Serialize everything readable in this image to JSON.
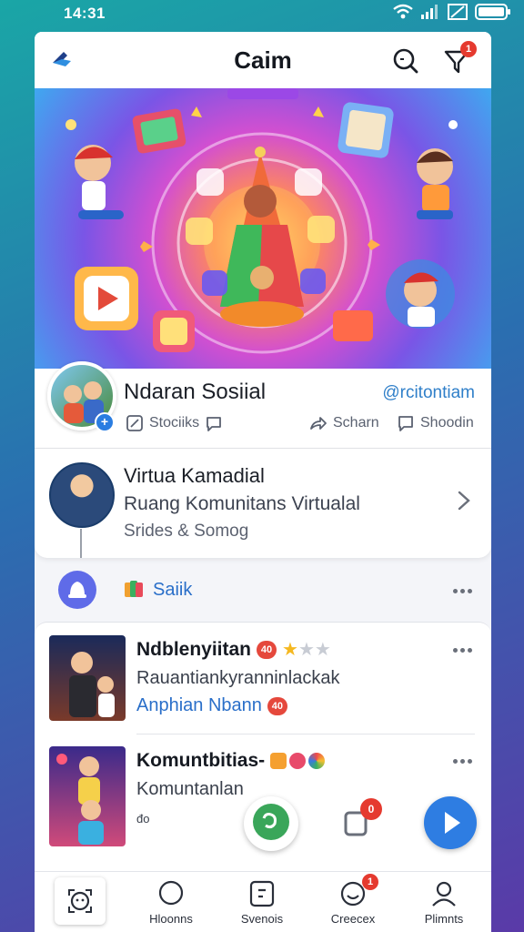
{
  "status_bar": {
    "time": "14:31"
  },
  "header": {
    "title": "Caim",
    "notification_count": "1"
  },
  "profile": {
    "name": "Ndaran Sosiial",
    "handle": "@rcitontiam",
    "stats": [
      "Stociiks",
      "Scharn",
      "Shoodin"
    ]
  },
  "community": {
    "title": "Virtua Kamadial",
    "subtitle": "Ruang Komunitans Virtualal",
    "meta": "Srides & Somog"
  },
  "tab": {
    "label": "Saiik"
  },
  "feed": [
    {
      "title": "Ndblenyiitan",
      "badge": "40",
      "rating": 1,
      "rating_max": 3,
      "subtitle": "Rauantiankyranninlackak",
      "link": "Anphian Nbann",
      "link_badge": "40"
    },
    {
      "title": "Komuntbitias-",
      "subtitle": "Komuntanlan",
      "meta": "đo"
    }
  ],
  "floating": {
    "doc_badge": "0"
  },
  "bottom_nav": [
    {
      "label": "",
      "icon": "home-icon"
    },
    {
      "label": "Hloonns",
      "icon": "chat-bubble-icon"
    },
    {
      "label": "Svenois",
      "icon": "doc-icon"
    },
    {
      "label": "Creecex",
      "icon": "smile-icon",
      "badge": "1"
    },
    {
      "label": "Plimnts",
      "icon": "profile-icon"
    }
  ],
  "colors": {
    "accent": "#2e7de2",
    "badge": "#e53a2f",
    "link": "#2a6fc9"
  }
}
